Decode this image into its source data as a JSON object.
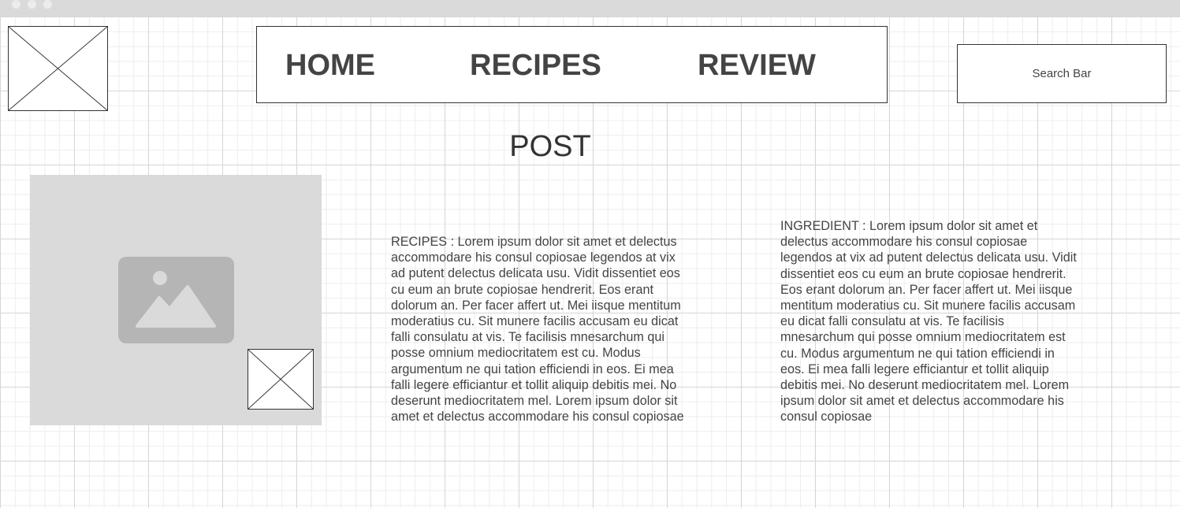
{
  "nav": {
    "home": "HOME",
    "recipes": "RECIPES",
    "review": "REVIEW"
  },
  "search": {
    "label": "Search Bar"
  },
  "post": {
    "title": "POST"
  },
  "content": {
    "recipes_text": "RECIPES : Lorem ipsum dolor sit amet et delectus\naccommodare his consul copiosae legendos at vix\nad putent delectus delicata usu. Vidit dissentiet eos\ncu eum an brute copiosae hendrerit. Eos erant\ndolorum an. Per facer affert ut. Mei iisque mentitum\nmoderatius cu. Sit munere facilis accusam eu dicat\nfalli consulatu at vis. Te facilisis mnesarchum qui\nposse omnium mediocritatem est cu. Modus\nargumentum ne qui tation efficiendi in eos. Ei mea\nfalli legere efficiantur et tollit aliquip debitis mei. No\ndeserunt mediocritatem mel. Lorem ipsum dolor sit\namet et delectus accommodare his consul copiosae",
    "ingredient_text": "INGREDIENT : Lorem ipsum dolor sit amet et\ndelectus accommodare his consul copiosae\nlegendos at vix ad putent delectus delicata usu. Vidit\ndissentiet eos cu eum an brute copiosae hendrerit.\nEos erant dolorum an. Per facer affert ut. Mei iisque\nmentitum moderatius cu. Sit munere facilis accusam\neu dicat falli consulatu at vis. Te facilisis\nmnesarchum qui posse omnium mediocritatem est\ncu. Modus argumentum ne qui tation efficiendi in\neos. Ei mea falli legere efficiantur et tollit aliquip\ndebitis mei. No deserunt mediocritatem mel. Lorem\nipsum dolor sit amet et delectus accommodare his\nconsul copiosae"
  },
  "icons": {
    "logo": "image-placeholder-icon",
    "main_image": "image-icon",
    "thumbnail": "image-placeholder-icon"
  },
  "colors": {
    "titlebar": "#dadada",
    "image_placeholder": "#dadada",
    "image_icon": "#b5b5b5",
    "text": "#444444"
  }
}
